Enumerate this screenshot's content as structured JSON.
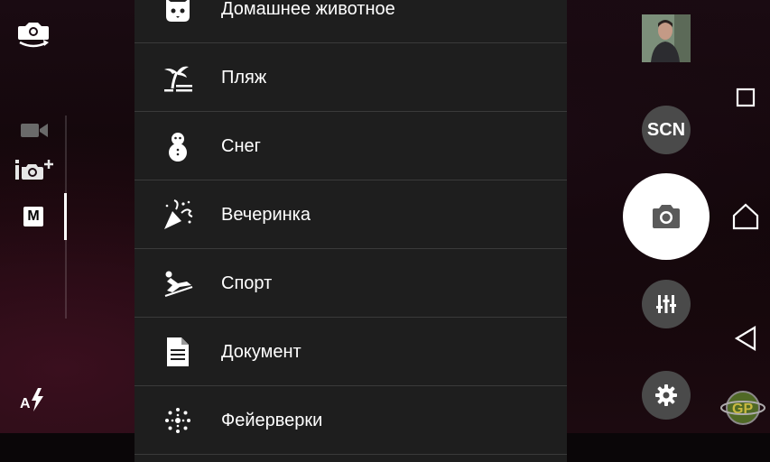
{
  "left_bar": {
    "icons": [
      "switch-camera-icon",
      "video-icon",
      "photo-plus-icon",
      "manual-mode-icon",
      "flash-auto-icon"
    ],
    "manual_label": "M"
  },
  "scenes": [
    {
      "label": "Домашнее животное",
      "icon": "pet-icon"
    },
    {
      "label": "Пляж",
      "icon": "beach-icon"
    },
    {
      "label": "Снег",
      "icon": "snowman-icon"
    },
    {
      "label": "Вечеринка",
      "icon": "party-icon"
    },
    {
      "label": "Спорт",
      "icon": "sport-icon"
    },
    {
      "label": "Документ",
      "icon": "document-icon"
    },
    {
      "label": "Фейерверки",
      "icon": "fireworks-icon"
    }
  ],
  "right_controls": {
    "scn_label": "SCN",
    "icons": [
      "last-photo-thumbnail",
      "shutter-camera-icon",
      "adjust-sliders-icon",
      "gear-icon"
    ]
  },
  "nav": {
    "icons": [
      "recents-icon",
      "home-icon",
      "back-icon"
    ]
  },
  "colors": {
    "panel": "#1e1e1e",
    "divider": "#3a3a3a",
    "button": "#4a4a4a",
    "shutter": "#ffffff"
  }
}
